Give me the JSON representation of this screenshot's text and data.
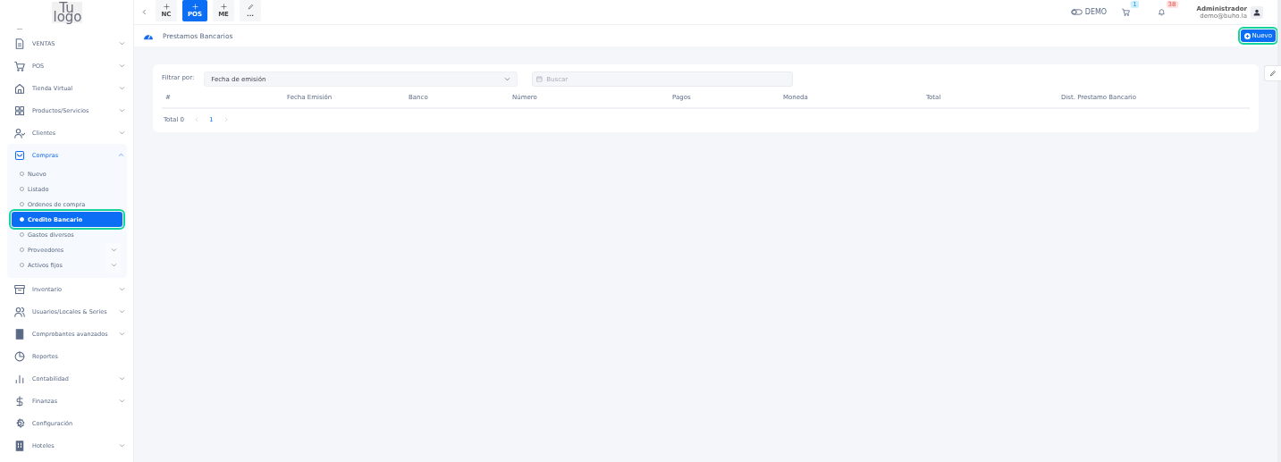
{
  "logo": {
    "line_1": "Tu",
    "line_2": "logo"
  },
  "sidebar": {
    "items": [
      {
        "label": "VENTAS",
        "expanded": false
      },
      {
        "label": "POS",
        "expanded": false
      },
      {
        "label": "Tienda Virtual",
        "expanded": false
      },
      {
        "label": "Productos/Servicios",
        "expanded": false
      },
      {
        "label": "Clientes",
        "expanded": false
      },
      {
        "label": "Compras",
        "expanded": true,
        "children": [
          {
            "label": "Nuevo",
            "selected": false
          },
          {
            "label": "Listado",
            "selected": false
          },
          {
            "label": "Ordenes de compra",
            "selected": false
          },
          {
            "label": "Credito Bancario",
            "selected": true
          },
          {
            "label": "Gastos diversos",
            "selected": false
          },
          {
            "label": "Proveedores",
            "selected": false,
            "expanded": false
          },
          {
            "label": "Activos fijos",
            "selected": false,
            "expanded": false
          }
        ]
      },
      {
        "label": "Inventario",
        "expanded": false
      },
      {
        "label": "Usuarios/Locales & Series",
        "expanded": false
      },
      {
        "label": "Comprobantes avanzados",
        "expanded": false
      },
      {
        "label": "Reportes"
      },
      {
        "label": "Contabilidad",
        "expanded": false
      },
      {
        "label": "Finanzas",
        "expanded": false
      },
      {
        "label": "Configuración"
      },
      {
        "label": "Hoteles",
        "expanded": false
      }
    ]
  },
  "toolbar": {
    "tabs": [
      {
        "kind": "plus",
        "label": "NC",
        "selected": false
      },
      {
        "kind": "plus",
        "label": "POS",
        "selected": true
      },
      {
        "kind": "plus",
        "label": "ME",
        "selected": false
      },
      {
        "kind": "pencil",
        "label": "...",
        "selected": false
      }
    ]
  },
  "header": {
    "demo": "DEMO",
    "cart_badge": "1",
    "notifications_badge": "38",
    "user_name": "Administrador",
    "user_email": "demo@buho.la"
  },
  "page": {
    "title": "Prestamos Bancarios",
    "new_button": "Nuevo"
  },
  "filter": {
    "label": "Filtrar por:",
    "value": "Fecha de emisión",
    "search_placeholder": "Buscar"
  },
  "table": {
    "columns": [
      "#",
      "Fecha Emisión",
      "Banco",
      "Número",
      "Pagos",
      "Moneda",
      "Total",
      "Dist. Prestamo Bancario"
    ]
  },
  "pagination": {
    "total": "Total 0",
    "pages": [
      {
        "label": "1",
        "selected": true
      }
    ]
  }
}
